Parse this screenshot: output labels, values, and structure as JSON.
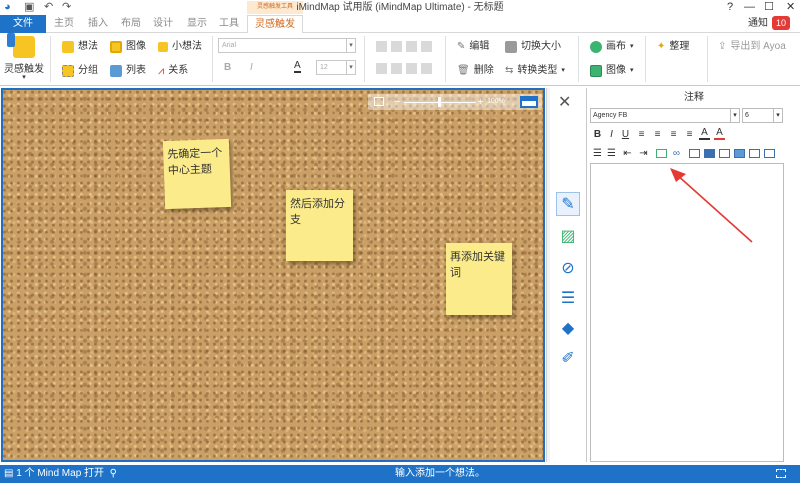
{
  "titlebar": {
    "app_title": "iMindMap 试用版 (iMindMap Ultimate) - 无标题",
    "context_tab_group": "灵感触发工具",
    "help": "?",
    "minimize": "—",
    "maximize": "☐",
    "close": "✕"
  },
  "tabs": {
    "file": "文件",
    "home": "主页",
    "insert": "插入",
    "layout": "布局",
    "design": "设计",
    "view": "显示",
    "tools": "工具",
    "active": "灵感触发",
    "notify": "通知",
    "notify_count": "10"
  },
  "ribbon": {
    "brainstorm_button": "灵感触发",
    "idea": "想法",
    "image": "图像",
    "small_idea": "小想法",
    "group": "分组",
    "list": "列表",
    "relationship": "关系",
    "font_name": "Arial",
    "font_size": "12",
    "bold": "B",
    "italic": "I",
    "edit": "编辑",
    "toggle_size": "切换大小",
    "delete": "删除",
    "convert_type": "转换类型",
    "canvas": "画布",
    "image_menu": "图像",
    "organize": "整理",
    "export_ayoa": "导出到 Ayoa"
  },
  "canvas": {
    "zoom_percent": "100%",
    "notes": [
      {
        "text": "先确定一个中心主题"
      },
      {
        "text": "然后添加分支"
      },
      {
        "text": "再添加关键词"
      }
    ]
  },
  "notes_panel": {
    "title": "注释",
    "font_name": "Agency FB",
    "font_size": "6",
    "bold": "B",
    "italic": "I",
    "underline": "U"
  },
  "statusbar": {
    "left": "1 个 Mind Map 打开",
    "center": "输入添加一个想法。"
  },
  "colors": {
    "accent": "#1e73c8",
    "context_tab": "#d2691e",
    "sticky_note": "#fbeb8b",
    "cork": "#caa067",
    "badge": "#e53935",
    "arrow": "#e53935"
  }
}
